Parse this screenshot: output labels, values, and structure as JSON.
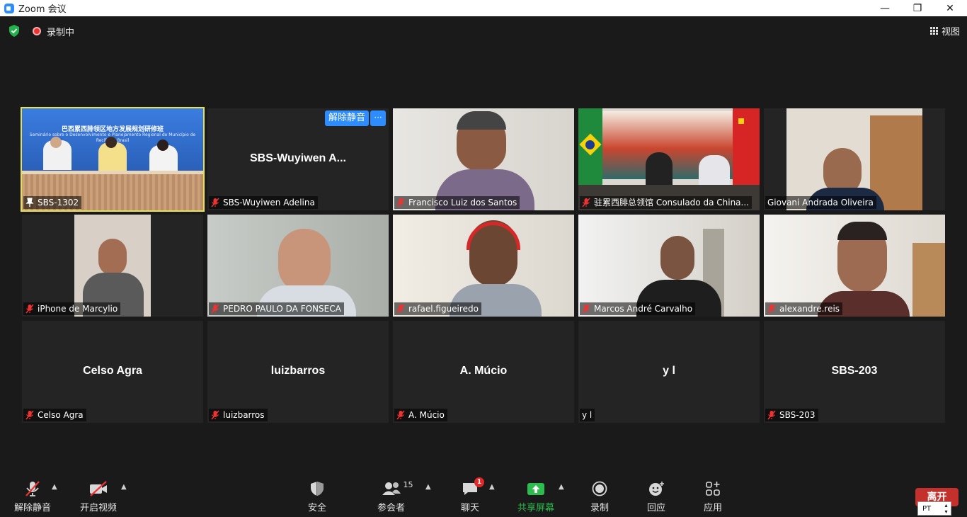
{
  "window": {
    "title": "Zoom 会议",
    "minimize": "—",
    "maximize": "❐",
    "close": "✕"
  },
  "topbar": {
    "recording_text": "录制中",
    "view_label": "视图"
  },
  "banner": {
    "title_cn": "巴西累西腓领区地方发展规划研修班",
    "subtitle_pt": "Seminário sobre o Desenvolvimento e Planejamento Regional do Município de Recife do Brasil"
  },
  "tiles": [
    {
      "name": "SBS-1302",
      "big_name": "",
      "muted": false,
      "pinned": true,
      "active": true
    },
    {
      "name": "SBS-Wuyiwen Adelina",
      "big_name": "SBS-Wuyiwen  A...",
      "muted": true,
      "unmute_label": "解除静音",
      "more_label": "···"
    },
    {
      "name": "Francisco Luiz dos Santos",
      "muted": true
    },
    {
      "name": "驻累西腓总领馆 Consulado da China...",
      "muted": true
    },
    {
      "name": "Giovani Andrada Oliveira",
      "muted": false
    },
    {
      "name": "iPhone de Marcylio",
      "muted": true
    },
    {
      "name": "PEDRO PAULO DA FONSECA",
      "muted": true
    },
    {
      "name": "rafael.figueiredo",
      "muted": true
    },
    {
      "name": "Marcos André Carvalho",
      "muted": true
    },
    {
      "name": "alexandre.reis",
      "muted": true
    },
    {
      "name": "Celso Agra",
      "big_name": "Celso Agra",
      "muted": true
    },
    {
      "name": "luizbarros",
      "big_name": "luizbarros",
      "muted": true
    },
    {
      "name": "A. Múcio",
      "big_name": "A. Múcio",
      "muted": true
    },
    {
      "name": "y l",
      "big_name": "y l",
      "muted": false
    },
    {
      "name": "SBS-203",
      "big_name": "SBS-203",
      "muted": true
    }
  ],
  "toolbar": {
    "unmute": "解除静音",
    "start_video": "开启视频",
    "security": "安全",
    "participants": "参会者",
    "participants_count": "15",
    "chat": "聊天",
    "chat_badge": "1",
    "share_screen": "共享屏幕",
    "record": "录制",
    "reactions": "回应",
    "apps": "应用",
    "leave": "离开",
    "ime_lang": "PT"
  },
  "colors": {
    "accent_blue": "#2d8cff",
    "share_green": "#2dbd4e",
    "leave_red": "#c4302b",
    "active_speaker": "#e6e14f"
  }
}
